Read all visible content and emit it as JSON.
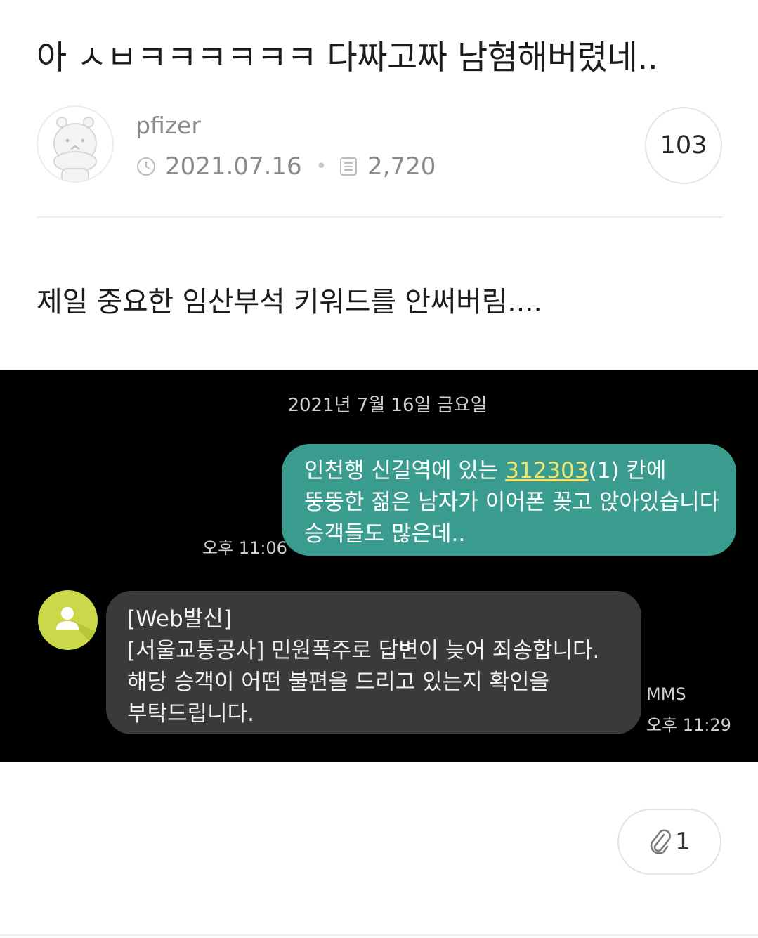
{
  "post": {
    "title": "아 ㅅㅂㅋㅋㅋㅋㅋㅋ 다짜고짜 남혐해버렸네..",
    "author": "pfizer",
    "date": "2021.07.16",
    "views": "2,720",
    "comment_count": "103",
    "body": "제일 중요한 임산부석 키워드를 안써버림...."
  },
  "sms": {
    "date_header": "2021년 7월 16일 금요일",
    "outgoing": {
      "line1_before": "인천행 신길역에 있는 ",
      "line1_highlight": "312303",
      "line1_after": "(1) 칸에",
      "line2": "뚱뚱한 젊은 남자가 이어폰 꽂고 앉아있습니다",
      "line3": "승객들도 많은데..",
      "time": "오후 11:06",
      "bubble_color": "#3a9c8e",
      "highlight_color": "#f3e36d"
    },
    "incoming": {
      "line1": "[Web발신]",
      "line2": "[서울교통공사] 민원폭주로 답변이 늦어 죄송합니다.",
      "line3": "해당 승객이 어떤 불편을 드리고 있는지 확인을",
      "line4": "부탁드립니다.",
      "type_label": "MMS",
      "time": "오후 11:29",
      "bubble_color": "#3a3a3a",
      "avatar_color": "#cad849"
    }
  },
  "attachments": {
    "count": "1",
    "icon": "paperclip-icon"
  },
  "icons": {
    "date": "clock-icon",
    "views": "document-icon",
    "author_avatar": "hippo-avatar-icon",
    "contact_avatar": "person-icon"
  }
}
